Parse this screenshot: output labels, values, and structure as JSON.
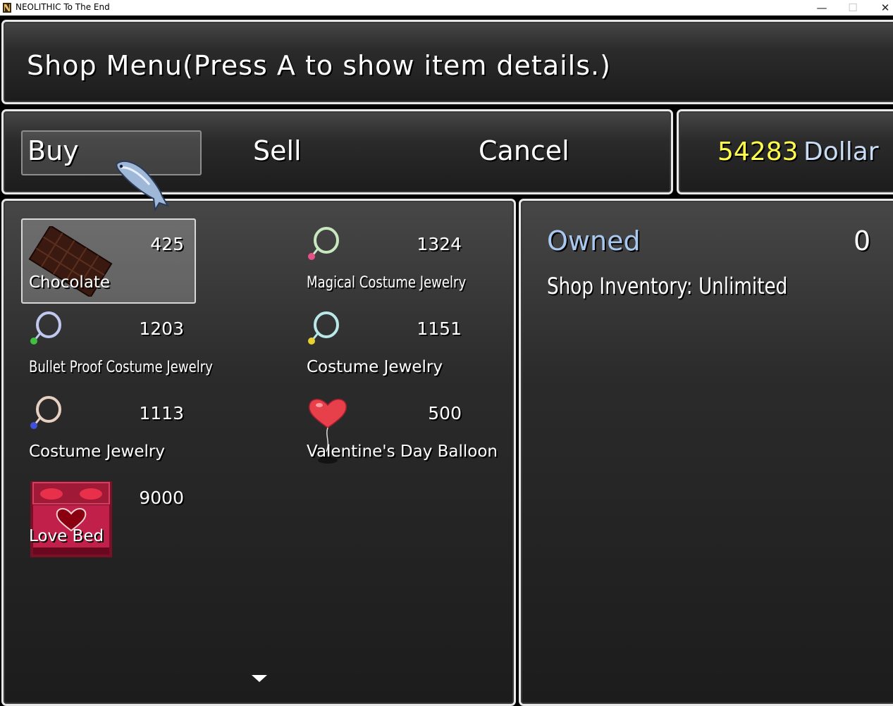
{
  "window": {
    "title": "NEOLITHIC To The End",
    "minimize_glyph": "—",
    "maximize_glyph": "☐",
    "close_glyph": "✕"
  },
  "help": {
    "text": "Shop Menu(Press A to show item details.)"
  },
  "commands": {
    "buy": "Buy",
    "sell": "Sell",
    "cancel": "Cancel",
    "selected": "buy"
  },
  "gold": {
    "value": "54283",
    "unit": "Dollar"
  },
  "items": [
    {
      "name": "Chocolate",
      "price": "425",
      "icon": "chocolate-bar-icon",
      "selected": true
    },
    {
      "name": "Magical Costume Jewelry",
      "price": "1324",
      "icon": "necklace-pink-gem-icon"
    },
    {
      "name": "Bullet Proof Costume Jewelry",
      "price": "1203",
      "icon": "necklace-green-gem-icon"
    },
    {
      "name": "Costume Jewelry",
      "price": "1151",
      "icon": "necklace-yellow-gem-icon"
    },
    {
      "name": "Costume Jewelry",
      "price": "1113",
      "icon": "necklace-blue-gem-icon"
    },
    {
      "name": "Valentine's Day Balloon",
      "price": "500",
      "icon": "heart-balloon-icon"
    },
    {
      "name": "Love Bed",
      "price": "9000",
      "icon": "heart-bed-icon"
    }
  ],
  "status": {
    "owned_label": "Owned",
    "owned_value": "0",
    "inventory": "Shop Inventory: Unlimited"
  },
  "colors": {
    "gold_value": "#ffff4c",
    "owned_label": "#a8c8f0",
    "gold_unit": "#c8dcf4"
  }
}
